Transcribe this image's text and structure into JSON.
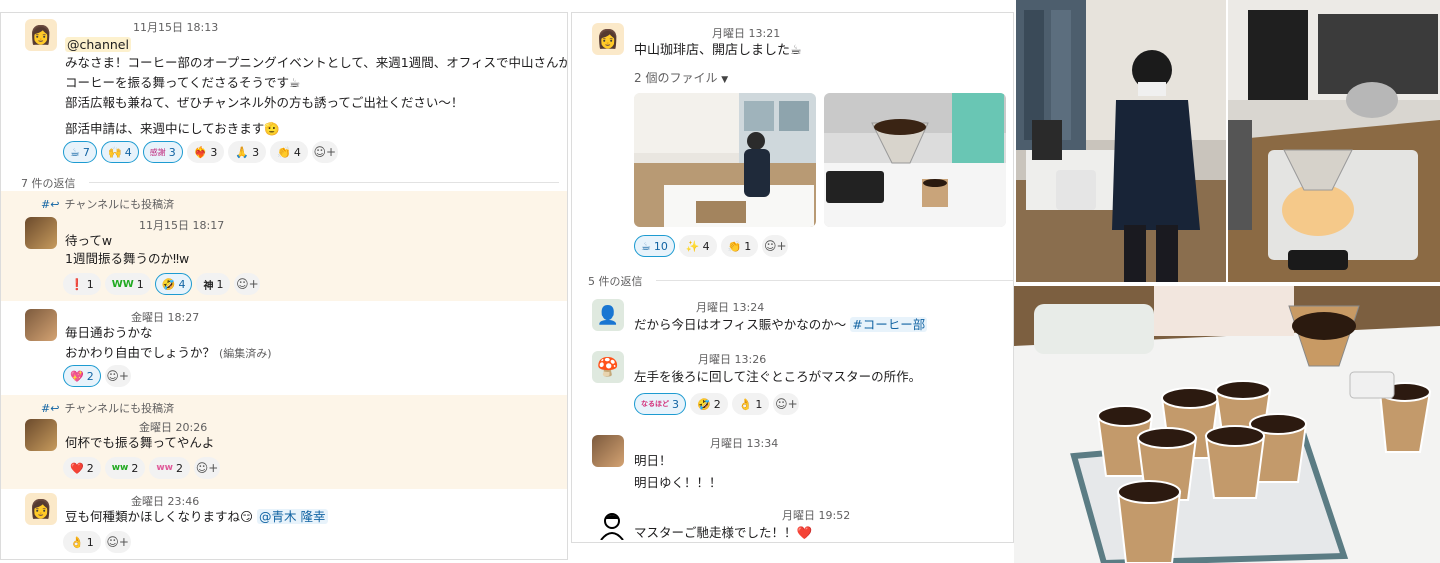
{
  "left": {
    "main_msg": {
      "time": "11月15日 18:13",
      "mention": "@channel",
      "line1": "みなさま！コーヒー部のオープニングイベントとして、来週1週間、オフィスで中山さんが",
      "line2": "コーヒーを振る舞ってくださるそうです☕",
      "line3": "部活広報も兼ねて、ぜひチャンネル外の方も誘ってご出社ください〜！",
      "line4": "部活申請は、来週中にしておきます🫡",
      "reactions": [
        {
          "emoji": "☕",
          "count": "7"
        },
        {
          "emoji": "🙌",
          "count": "4"
        },
        {
          "emoji": "感謝",
          "count": "3"
        },
        {
          "emoji": "❤️‍🔥",
          "count": "3"
        },
        {
          "emoji": "🙏",
          "count": "3"
        },
        {
          "emoji": "👏",
          "count": "4"
        }
      ]
    },
    "reply_count": "7 件の返信",
    "also_sent_label": "チャンネルにも投稿済",
    "r1": {
      "time": "11月15日 18:17",
      "line1": "待ってw",
      "line2": "1週間振る舞うのか‼w",
      "reactions": [
        {
          "emoji": "❗",
          "count": "1"
        },
        {
          "emoji": "WW",
          "count": "1"
        },
        {
          "emoji": "🤣",
          "count": "4"
        },
        {
          "emoji": "神",
          "count": "1"
        }
      ]
    },
    "r2": {
      "time": "金曜日 18:27",
      "line1": "毎日通おうかな",
      "line2": "おかわり自由でしょうか？",
      "edited": "(編集済み)",
      "reactions": [
        {
          "emoji": "💖",
          "count": "2"
        }
      ]
    },
    "r3": {
      "time": "金曜日 20:26",
      "line1": "何杯でも振る舞ってやんよ",
      "reactions": [
        {
          "emoji": "❤️",
          "count": "2"
        },
        {
          "emoji": "ww",
          "count": "2"
        },
        {
          "emoji": "ww",
          "count": "2"
        }
      ]
    },
    "r4": {
      "time": "金曜日 23:46",
      "line1": "豆も何種類かほしくなりますね😏",
      "mention": "@青木 隆幸",
      "reactions": [
        {
          "emoji": "👌",
          "count": "1"
        }
      ]
    }
  },
  "right": {
    "main_msg": {
      "time": "月曜日 13:21",
      "line1": "中山珈琲店、開店しました☕",
      "files_label": "2 個のファイル",
      "reactions": [
        {
          "emoji": "☕",
          "count": "10"
        },
        {
          "emoji": "✨",
          "count": "4"
        },
        {
          "emoji": "👏",
          "count": "1"
        }
      ]
    },
    "reply_count": "5 件の返信",
    "r1": {
      "time": "月曜日 13:24",
      "line1": "だから今日はオフィス賑やかなのか〜",
      "channel": "#コーヒー部"
    },
    "r2": {
      "time": "月曜日 13:26",
      "line1": "左手を後ろに回して注ぐところがマスターの所作。",
      "reactions": [
        {
          "emoji": "なるほど",
          "count": "3"
        },
        {
          "emoji": "🤣",
          "count": "2"
        },
        {
          "emoji": "👌",
          "count": "1"
        }
      ]
    },
    "r3": {
      "time": "月曜日 13:34",
      "line1": "明日！",
      "line2": "明日ゆく！！！"
    },
    "r4": {
      "time": "月曜日 19:52",
      "line1": "マスターご馳走様でした！！❤️"
    }
  },
  "colors": {
    "accent": "#1264a3",
    "highlight": "#fdf5e8",
    "mention_bg": "#fdf1ce"
  }
}
